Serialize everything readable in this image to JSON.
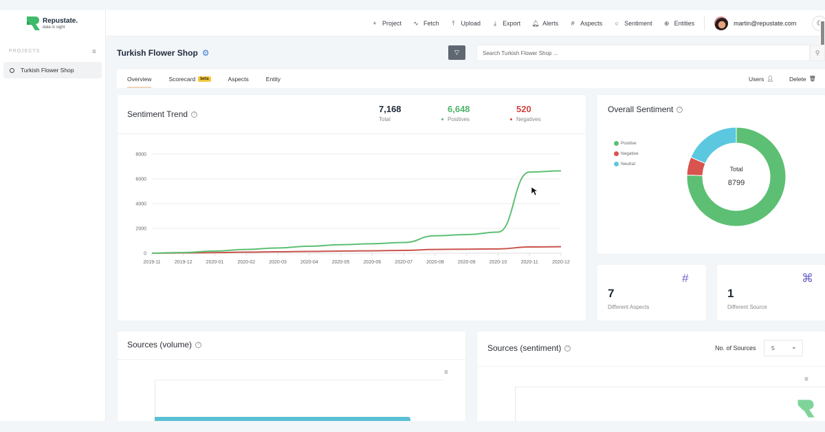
{
  "app": {
    "name": "Repustate.",
    "tagline": "data in sight",
    "brand_color": "#3dbb6a"
  },
  "nav": {
    "items": [
      {
        "icon": "+",
        "label": "Project",
        "name": "plus-icon"
      },
      {
        "icon": "∿",
        "label": "Fetch",
        "name": "activity-icon"
      },
      {
        "icon": "⤒",
        "label": "Upload",
        "name": "upload-icon"
      },
      {
        "icon": "⤓",
        "label": "Export",
        "name": "download-icon"
      },
      {
        "icon": "🔔︎",
        "label": "Alerts",
        "name": "bell-icon"
      },
      {
        "icon": "#",
        "label": "Aspects",
        "name": "hash-icon"
      },
      {
        "icon": "○",
        "label": "Sentiment",
        "name": "circle-icon"
      },
      {
        "icon": "⊕",
        "label": "Entities",
        "name": "globe-icon"
      }
    ],
    "user_email": "martin@repustate.com",
    "theme_icon": "☾"
  },
  "sidebar": {
    "heading": "PROJECTS",
    "menu_icon": "≡",
    "projects": [
      {
        "label": "Turkish Flower Shop"
      }
    ]
  },
  "project": {
    "title": "Turkish Flower Shop",
    "settings_icon": "⚙",
    "filter_icon": "▽",
    "search_placeholder": "Search Turkish Flower Shop ...",
    "search_icon": "⚲"
  },
  "tabs": {
    "items": [
      {
        "label": "Overview",
        "active": true
      },
      {
        "label": "Scorecard",
        "badge": "beta"
      },
      {
        "label": "Aspects"
      },
      {
        "label": "Entity"
      }
    ],
    "users_label": "Users",
    "users_icon": "👤︎",
    "delete_label": "Delete",
    "delete_icon": "🗑︎"
  },
  "sentiment_trend": {
    "title": "Sentiment Trend",
    "help": "?",
    "total": {
      "value": "7,168",
      "label": "Total"
    },
    "positives": {
      "value": "6,648",
      "label": "Positives",
      "color": "#4fb46a"
    },
    "negatives": {
      "value": "520",
      "label": "Negatives",
      "color": "#d0443f"
    }
  },
  "overall_sentiment": {
    "title": "Overall Sentiment",
    "help": "?",
    "center_label": "Total",
    "center_value": "8799"
  },
  "aspects_card": {
    "value": "7",
    "label": "Different Aspects",
    "icon": "#"
  },
  "sources_card": {
    "value": "1",
    "label": "Different Source",
    "icon": "⌘"
  },
  "sources_volume": {
    "title": "Sources (volume)",
    "help": "?",
    "menu_icon": "≡"
  },
  "sources_sentiment": {
    "title": "Sources (sentiment)",
    "help": "?",
    "count_label": "No. of Sources",
    "count_value": "5",
    "chevron": "⌄",
    "menu_icon": "≡"
  },
  "chart_data": [
    {
      "type": "line",
      "title": "Sentiment Trend",
      "xlabel": "",
      "ylabel": "",
      "x": [
        "2019-11",
        "2019-12",
        "2020-01",
        "2020-02",
        "2020-03",
        "2020-04",
        "2020-05",
        "2020-06",
        "2020-07",
        "2020-08",
        "2020-09",
        "2020-10",
        "2020-11",
        "2020-12"
      ],
      "ylim": [
        0,
        8000
      ],
      "yticks": [
        0,
        2000,
        4000,
        6000,
        8000
      ],
      "grid": true,
      "series": [
        {
          "name": "Positives",
          "color": "#5cbf73",
          "values": [
            0,
            50,
            170,
            300,
            420,
            560,
            680,
            760,
            860,
            1400,
            1500,
            1700,
            6550,
            6648
          ]
        },
        {
          "name": "Negatives",
          "color": "#c9534c",
          "values": [
            0,
            20,
            40,
            80,
            110,
            140,
            170,
            190,
            220,
            300,
            320,
            340,
            500,
            520
          ]
        }
      ]
    },
    {
      "type": "pie",
      "title": "Overall Sentiment",
      "legend": "left",
      "slices": [
        {
          "label": "Positive",
          "value": 6648,
          "color": "#5cbf73"
        },
        {
          "label": "Negative",
          "value": 520,
          "color": "#d9534f"
        },
        {
          "label": "Neutral",
          "value": 1631,
          "color": "#5bc8e0"
        }
      ],
      "total": 8799
    }
  ]
}
